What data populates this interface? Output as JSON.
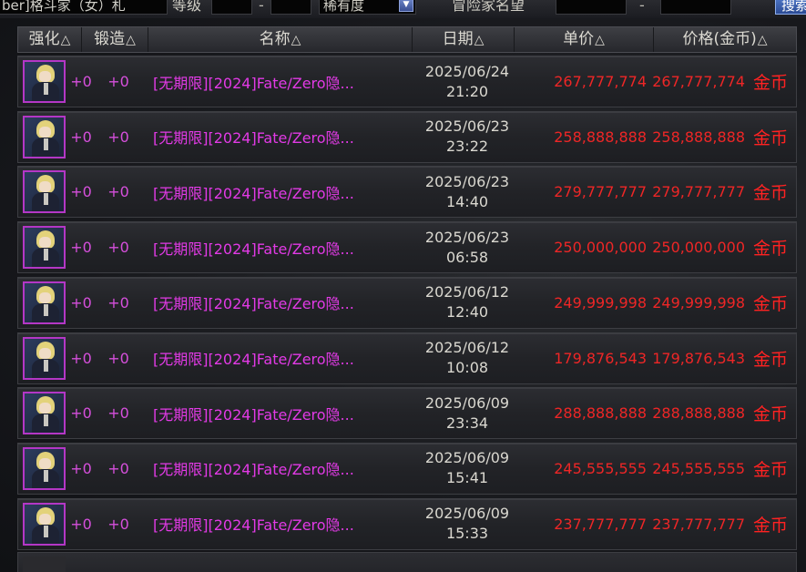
{
  "filters": {
    "class_value": "ber]格斗家（女）札",
    "level_label": "等级",
    "rarity_value": "稀有度",
    "fame_label": "冒险家名望",
    "level_dash": "-",
    "fame_dash": "-",
    "search_label": "搜索"
  },
  "columns": {
    "strength": "强化",
    "forge": "锻造",
    "name": "名称",
    "date": "日期",
    "unit_price": "单价",
    "total_price": "价格(金币)",
    "sort_glyph": "△"
  },
  "rows": [
    {
      "strength": "+0",
      "forge": "+0",
      "name": "[无期限][2024]Fate/Zero隐...",
      "date": "2025/06/24",
      "time": "21:20",
      "unit_price": "267,777,774",
      "total_price": "267,777,774",
      "currency": "金币"
    },
    {
      "strength": "+0",
      "forge": "+0",
      "name": "[无期限][2024]Fate/Zero隐...",
      "date": "2025/06/23",
      "time": "23:22",
      "unit_price": "258,888,888",
      "total_price": "258,888,888",
      "currency": "金币"
    },
    {
      "strength": "+0",
      "forge": "+0",
      "name": "[无期限][2024]Fate/Zero隐...",
      "date": "2025/06/23",
      "time": "14:40",
      "unit_price": "279,777,777",
      "total_price": "279,777,777",
      "currency": "金币"
    },
    {
      "strength": "+0",
      "forge": "+0",
      "name": "[无期限][2024]Fate/Zero隐...",
      "date": "2025/06/23",
      "time": "06:58",
      "unit_price": "250,000,000",
      "total_price": "250,000,000",
      "currency": "金币"
    },
    {
      "strength": "+0",
      "forge": "+0",
      "name": "[无期限][2024]Fate/Zero隐...",
      "date": "2025/06/12",
      "time": "12:40",
      "unit_price": "249,999,998",
      "total_price": "249,999,998",
      "currency": "金币"
    },
    {
      "strength": "+0",
      "forge": "+0",
      "name": "[无期限][2024]Fate/Zero隐...",
      "date": "2025/06/12",
      "time": "10:08",
      "unit_price": "179,876,543",
      "total_price": "179,876,543",
      "currency": "金币"
    },
    {
      "strength": "+0",
      "forge": "+0",
      "name": "[无期限][2024]Fate/Zero隐...",
      "date": "2025/06/09",
      "time": "23:34",
      "unit_price": "288,888,888",
      "total_price": "288,888,888",
      "currency": "金币"
    },
    {
      "strength": "+0",
      "forge": "+0",
      "name": "[无期限][2024]Fate/Zero隐...",
      "date": "2025/06/09",
      "time": "15:41",
      "unit_price": "245,555,555",
      "total_price": "245,555,555",
      "currency": "金币"
    },
    {
      "strength": "+0",
      "forge": "+0",
      "name": "[无期限][2024]Fate/Zero隐...",
      "date": "2025/06/09",
      "time": "15:33",
      "unit_price": "237,777,777",
      "total_price": "237,777,777",
      "currency": "金币"
    }
  ],
  "colors": {
    "item_name": "#e23ae6",
    "price": "#ee2626",
    "currency": "#ff2222",
    "item_border": "#b437c6"
  },
  "icons": {
    "item_thumbnail": "saber-avatar-icon",
    "sort": "sort-triangle-icon",
    "dropdown": "chevron-down-icon"
  }
}
